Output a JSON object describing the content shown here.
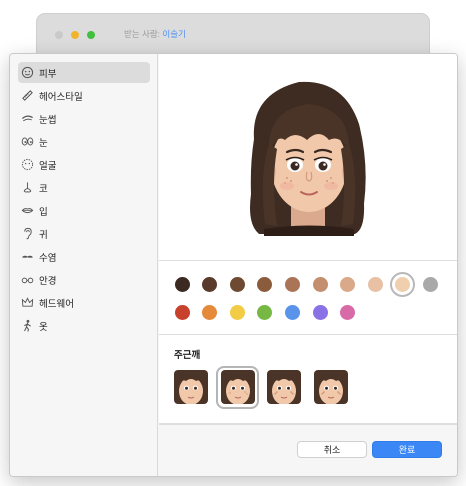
{
  "background_window": {
    "recipient_label": "받는 사람:",
    "recipient_name": "이슬기"
  },
  "sidebar": {
    "items": [
      {
        "label": "피부",
        "icon": "face-icon",
        "selected": true
      },
      {
        "label": "헤어스타일",
        "icon": "comb-icon"
      },
      {
        "label": "눈썹",
        "icon": "eyebrow-icon"
      },
      {
        "label": "눈",
        "icon": "eyes-icon"
      },
      {
        "label": "얼굴",
        "icon": "face-outline-icon"
      },
      {
        "label": "코",
        "icon": "nose-icon"
      },
      {
        "label": "입",
        "icon": "lips-icon"
      },
      {
        "label": "귀",
        "icon": "ear-icon"
      },
      {
        "label": "수염",
        "icon": "mustache-icon"
      },
      {
        "label": "안경",
        "icon": "glasses-icon"
      },
      {
        "label": "헤드웨어",
        "icon": "crown-icon"
      },
      {
        "label": "옷",
        "icon": "person-icon"
      }
    ]
  },
  "skin_colors": [
    "#3b2a22",
    "#5a3a2a",
    "#6e4a32",
    "#8a5c3c",
    "#a97556",
    "#c48f6f",
    "#d9a98a",
    "#e8c0a4",
    "#efcfae",
    "#a9a9a9",
    "#c8412d",
    "#e5893a",
    "#f2cc45",
    "#77b845",
    "#5a93ea",
    "#8a72e6",
    "#d96aa8"
  ],
  "selected_skin_color_index": 8,
  "freckles": {
    "title": "주근깨",
    "options": [
      "freckles-none",
      "freckles-light",
      "freckles-medium",
      "freckles-heavy"
    ],
    "selected_index": 1
  },
  "footer": {
    "cancel_label": "취소",
    "done_label": "완료"
  }
}
